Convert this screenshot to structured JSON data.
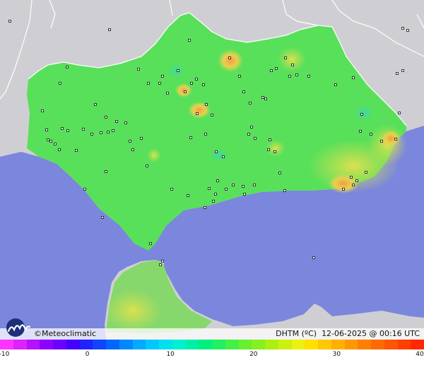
{
  "map": {
    "credit": "©Meteoclimatic",
    "variable": "DHTM (ºC)",
    "timestamp": "12-06-2025 @ 00:16 UTC",
    "colors": {
      "sea": "#7b86dd",
      "land_outside": "#cfcfd3",
      "region": "#58e05a",
      "warm_spots": "#f2c04a"
    },
    "stations_shown": true
  },
  "scale": {
    "ticks": [
      "-10",
      "0",
      "10",
      "20",
      "30",
      "40"
    ],
    "colors": [
      "#ff33ff",
      "#dd22ff",
      "#b511ff",
      "#8f00ff",
      "#6a00ff",
      "#4400ff",
      "#2222ff",
      "#1144ff",
      "#0066ff",
      "#0088ff",
      "#00aaff",
      "#00c8ff",
      "#00e0f0",
      "#00f0d0",
      "#00f0a8",
      "#00f080",
      "#22f060",
      "#44f045",
      "#66f030",
      "#88f020",
      "#aaf010",
      "#ccf010",
      "#eef010",
      "#ffe000",
      "#ffc800",
      "#ffb000",
      "#ff9800",
      "#ff8000",
      "#ff6a00",
      "#ff5400",
      "#ff3e00",
      "#ff2800"
    ]
  }
}
